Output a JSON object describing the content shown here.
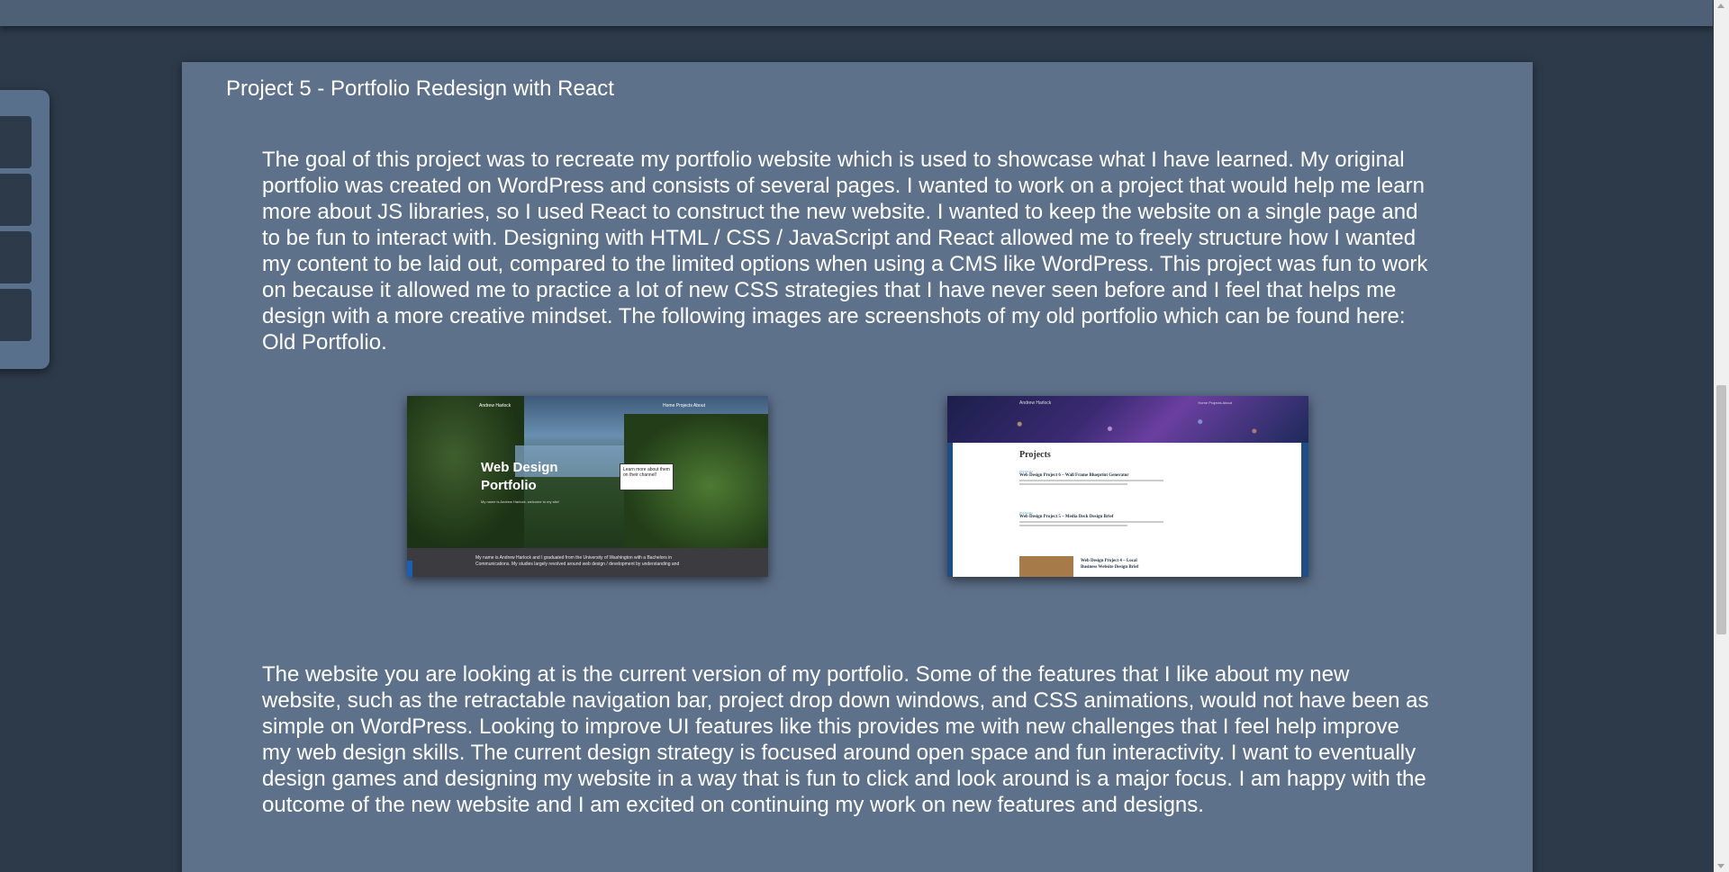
{
  "project": {
    "title": "Project 5 - Portfolio Redesign with React",
    "paragraph1_text": "The goal of this project was to recreate my portfolio website which is used to showcase what I have learned. My original portfolio was created on WordPress and consists of several pages. I wanted to work on a project that would help me learn more about JS libraries, so I used React to construct the new website. I wanted to keep the website on a single page and to be fun to interact with. Designing with HTML / CSS / JavaScript and React allowed me to freely structure how I wanted my content to be laid out, compared to the limited options when using a CMS like WordPress. This project was fun to work on because it allowed me to practice a lot of new CSS strategies that I have never seen before and I feel that helps me design with a more creative mindset. The following images are screenshots of my old portfolio which can be found here: ",
    "old_portfolio_link": "Old Portfolio",
    "paragraph1_end": ".",
    "paragraph2": "The website you are looking at is the current version of my portfolio. Some of the features that I like about my new website, such as the retractable navigation bar, project drop down windows, and CSS animations, would not have been as simple on WordPress. Looking to improve UI features like this provides me with new challenges that I feel help improve my web design skills. The current design strategy is focused around open space and fun interactivity. I want to eventually design games and designing my website in a way that is fun to click and look around is a major focus. I am happy with the outcome of the new website and I am excited on continuing my work on new features and designs."
  },
  "screenshot1": {
    "brand": "Andrew Harlock",
    "nav": "Home  Projects  About",
    "hero_title": "Web Design Portfolio",
    "hero_sub": "My name is Andrew Harlock, welcome to my site!",
    "card_text": "Learn more about them on their channel!",
    "bottom_text": "My name is Andrew Harlock and I graduated from the University of Washington with a Bachelors in Communications. My studies largely revolved around web design / development by understanding and"
  },
  "screenshot2": {
    "brand": "Andrew Harlock",
    "nav": "Home  Projects  About",
    "heading": "Projects",
    "entries": [
      {
        "cat": "Web Design",
        "title": "Web Design Project 6 – Wall Frame Blueprint Generator"
      },
      {
        "cat": "Web Design",
        "title": "Web Design Project 5 – Media Deck Design Brief"
      }
    ],
    "entry3_title": "Web Design Project 4 – Local Business Website Design Brief"
  },
  "colors": {
    "background": "#2c3a4a",
    "panel": "#5e718b",
    "topbar": "#4d6076",
    "text": "#ffffff"
  }
}
